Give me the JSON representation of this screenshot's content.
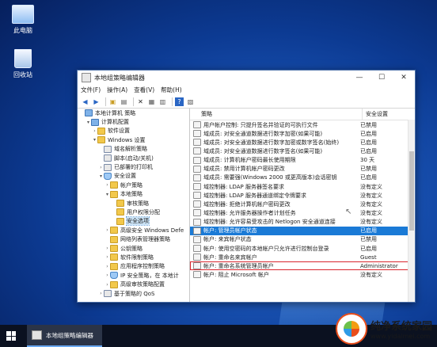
{
  "desktop": {
    "icons": [
      {
        "label": "此电脑",
        "icon": "computer-icon"
      },
      {
        "label": "回收站",
        "icon": "recycle-bin-icon"
      }
    ]
  },
  "window": {
    "title": "本地组策略编辑器",
    "controls": {
      "minimize": "—",
      "maximize": "☐",
      "close": "✕"
    },
    "menu": [
      "文件(F)",
      "操作(A)",
      "查看(V)",
      "帮助(H)"
    ]
  },
  "tree": [
    {
      "label": "本地计算机 策略",
      "depth": 0,
      "caret": "",
      "icon": "computer-icon"
    },
    {
      "label": "计算机配置",
      "depth": 1,
      "caret": "▾",
      "icon": "computer-icon"
    },
    {
      "label": "软件设置",
      "depth": 2,
      "caret": "›",
      "icon": "folder-icon"
    },
    {
      "label": "Windows 设置",
      "depth": 2,
      "caret": "▾",
      "icon": "folder-icon"
    },
    {
      "label": "域名解析策略",
      "depth": 3,
      "caret": "",
      "icon": "chart-icon"
    },
    {
      "label": "脚本(启动/关机)",
      "depth": 3,
      "caret": "",
      "icon": "document-icon"
    },
    {
      "label": "已部署的打印机",
      "depth": 3,
      "caret": "›",
      "icon": "printer-icon"
    },
    {
      "label": "安全设置",
      "depth": 3,
      "caret": "▾",
      "icon": "shield-icon"
    },
    {
      "label": "帐户策略",
      "depth": 4,
      "caret": "›",
      "icon": "folder-icon"
    },
    {
      "label": "本地策略",
      "depth": 4,
      "caret": "▾",
      "icon": "folder-icon"
    },
    {
      "label": "审核策略",
      "depth": 5,
      "caret": "",
      "icon": "folder-icon"
    },
    {
      "label": "用户权限分配",
      "depth": 5,
      "caret": "",
      "icon": "folder-icon"
    },
    {
      "label": "安全选项",
      "depth": 5,
      "caret": "",
      "icon": "folder-icon",
      "selected": true
    },
    {
      "label": "高级安全 Windows Defe",
      "depth": 4,
      "caret": "›",
      "icon": "folder-icon"
    },
    {
      "label": "网络列表管理器策略",
      "depth": 4,
      "caret": "",
      "icon": "folder-icon"
    },
    {
      "label": "公钥策略",
      "depth": 4,
      "caret": "›",
      "icon": "folder-icon"
    },
    {
      "label": "软件限制策略",
      "depth": 4,
      "caret": "›",
      "icon": "folder-icon"
    },
    {
      "label": "应用程序控制策略",
      "depth": 4,
      "caret": "›",
      "icon": "folder-icon"
    },
    {
      "label": "IP 安全策略，在 本地计",
      "depth": 4,
      "caret": "›",
      "icon": "shield-icon"
    },
    {
      "label": "高级审核策略配置",
      "depth": 4,
      "caret": "›",
      "icon": "folder-icon"
    },
    {
      "label": "基于策略的 QoS",
      "depth": 3,
      "caret": "›",
      "icon": "chart-icon"
    }
  ],
  "list": {
    "headers": {
      "policy": "策略",
      "setting": "安全设置"
    },
    "rows": [
      {
        "policy": "用户帐户控制: 只提升签名并验证的可执行文件",
        "setting": "已禁用"
      },
      {
        "policy": "域成员: 对安全通道数据进行数字加密(如果可能)",
        "setting": "已启用"
      },
      {
        "policy": "域成员: 对安全通道数据进行数字加密或数字签名(始终)",
        "setting": "已启用"
      },
      {
        "policy": "域成员: 对安全通道数据进行数字签名(如果可能)",
        "setting": "已启用"
      },
      {
        "policy": "域成员: 计算机帐户密码最长使用期限",
        "setting": "30 天"
      },
      {
        "policy": "域成员: 禁用计算机帐户密码更改",
        "setting": "已禁用"
      },
      {
        "policy": "域成员: 需要强(Windows 2000 或更高版本)会话密钥",
        "setting": "已启用"
      },
      {
        "policy": "域控制器: LDAP 服务器签名要求",
        "setting": "没有定义"
      },
      {
        "policy": "域控制器: LDAP 服务器通道绑定令牌要求",
        "setting": "没有定义"
      },
      {
        "policy": "域控制器: 拒绝计算机帐户密码更改",
        "setting": "没有定义"
      },
      {
        "policy": "域控制器: 允许服务器操作者计划任务",
        "setting": "没有定义"
      },
      {
        "policy": "域控制器: 允许容易受攻击的 Netlogon 安全通道连接",
        "setting": "没有定义"
      },
      {
        "policy": "帐户: 管理员帐户状态",
        "setting": "已启用",
        "selected": true
      },
      {
        "policy": "帐户: 来宾帐户状态",
        "setting": "已禁用"
      },
      {
        "policy": "帐户: 使用空密码的本地帐户只允许进行控制台登录",
        "setting": "已启用"
      },
      {
        "policy": "帐户: 重命名来宾帐户",
        "setting": "Guest"
      },
      {
        "policy": "帐户: 重命名系统管理员帐户",
        "setting": "Administrator",
        "boxed": true
      },
      {
        "policy": "帐户: 阻止 Microsoft 帐户",
        "setting": "没有定义"
      }
    ]
  },
  "taskbar": {
    "app_label": "本地组策略编辑器"
  },
  "watermark": {
    "title": "纯净系统家园",
    "url": "www.yidaimei.com"
  }
}
